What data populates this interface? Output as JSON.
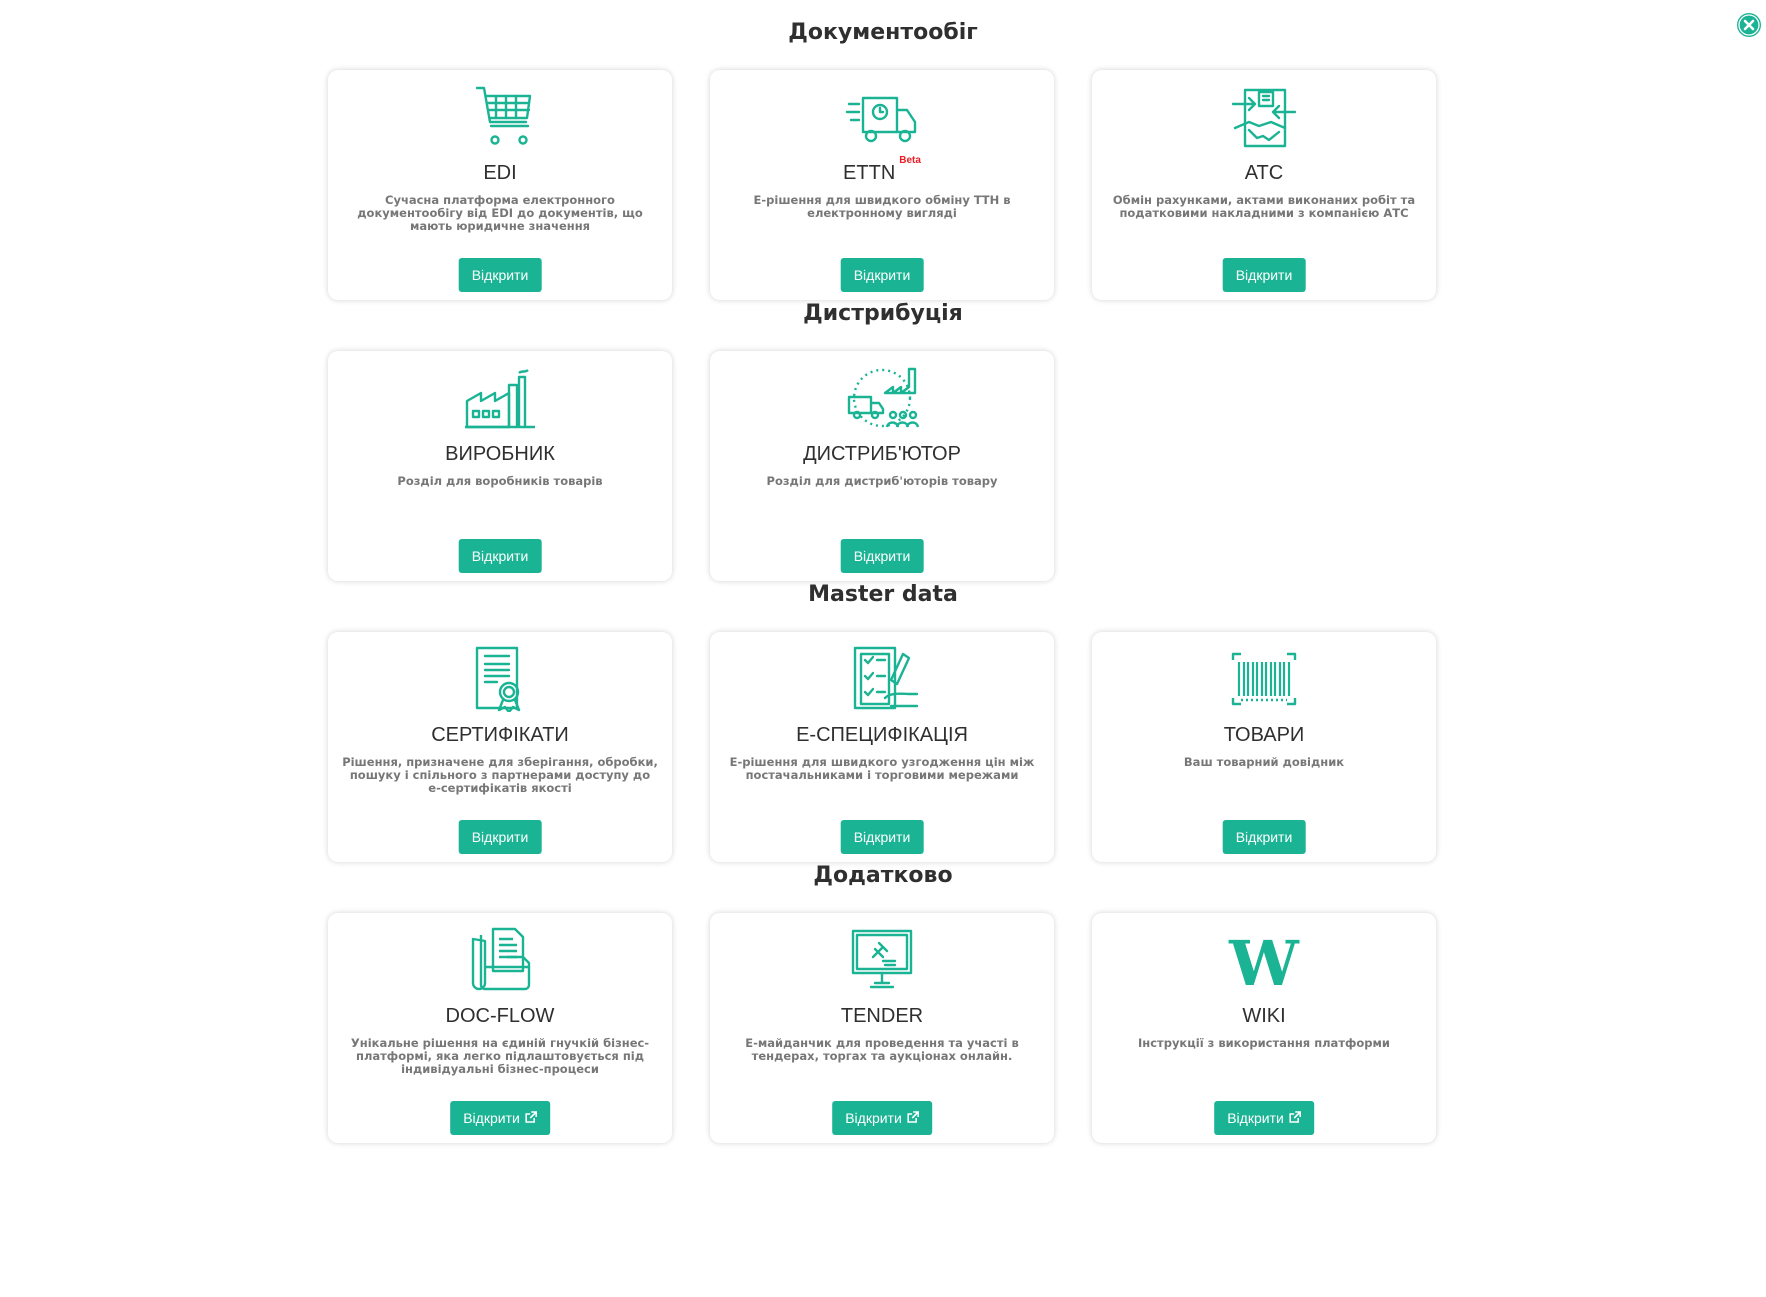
{
  "accent": "#1ab394",
  "close_icon": "close-circle-icon",
  "button_label": "Відкрити",
  "sections": [
    {
      "title": "Документообіг",
      "cards": [
        {
          "name": "EDI",
          "badge": "",
          "desc": "Сучасна платформа електронного документообігу від EDI до документів, що мають юридичне значення",
          "icon": "cart-icon",
          "external": false
        },
        {
          "name": "ETTN",
          "badge": "Beta",
          "desc": "Е-рішення для швидкого обміну ТТН в електронному вигляді",
          "icon": "truck-icon",
          "external": false
        },
        {
          "name": "АТС",
          "badge": "",
          "desc": "Обмін рахунками, актами виконаних робіт та податковими накладними з компанією АТС",
          "icon": "handshake-icon",
          "external": false
        }
      ]
    },
    {
      "title": "Дистрибуція",
      "cards": [
        {
          "name": "ВИРОБНИК",
          "badge": "",
          "desc": "Розділ для воробників товарів",
          "icon": "factory-icon",
          "external": false
        },
        {
          "name": "ДИСТРИБ'ЮТОР",
          "badge": "",
          "desc": "Розділ для дистриб'юторів товару",
          "icon": "distribution-icon",
          "external": false
        }
      ]
    },
    {
      "title": "Master data",
      "cards": [
        {
          "name": "СЕРТИФІКАТИ",
          "badge": "",
          "desc": "Рішення, призначене для зберігання, обробки, пошуку і спільного з партнерами доступу до е-сертифікатів якості",
          "icon": "certificate-icon",
          "external": false
        },
        {
          "name": "Е-СПЕЦИФІКАЦІЯ",
          "badge": "",
          "desc": "Е-рішення для швидкого узгодження цін між постачальниками і торговими мережами",
          "icon": "checklist-icon",
          "external": false
        },
        {
          "name": "ТОВАРИ",
          "badge": "",
          "desc": "Ваш товарний довідник",
          "icon": "barcode-icon",
          "external": false
        }
      ]
    },
    {
      "title": "Додатково",
      "cards": [
        {
          "name": "DOC-FLOW",
          "badge": "",
          "desc": "Унікальне рішення на єдиній гнучкій бізнес-платформі, яка легко підлаштовується під індивідуальні бізнес-процеси",
          "icon": "folder-docs-icon",
          "external": true
        },
        {
          "name": "TENDER",
          "badge": "",
          "desc": "Е-майданчик для проведення та участі в тендерах, торгах та аукціонах онлайн.",
          "icon": "auction-monitor-icon",
          "external": true
        },
        {
          "name": "WIKI",
          "badge": "",
          "desc": "Інструкції з використання платформи",
          "icon": "wiki-icon",
          "external": true
        }
      ]
    }
  ]
}
